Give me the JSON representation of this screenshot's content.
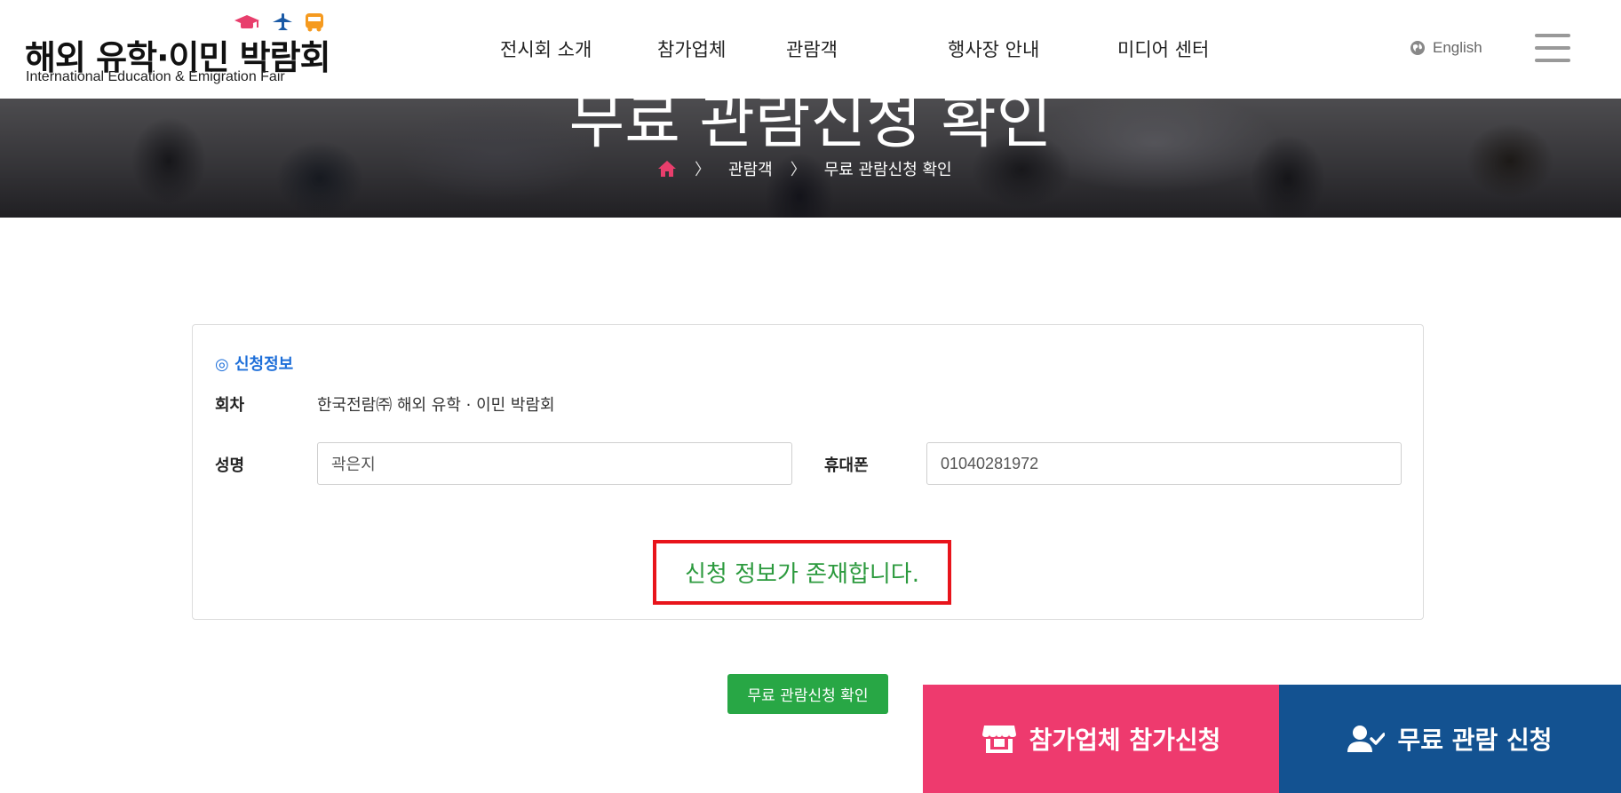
{
  "logo": {
    "title": "해외 유학·이민 박람회",
    "subtitle": "International Education & Emigration Fair",
    "icons": [
      "graduation-cap-icon",
      "airplane-icon",
      "bus-icon"
    ],
    "icon_colors": [
      "#e83e6c",
      "#1a5aa6",
      "#f59a1f"
    ]
  },
  "nav": {
    "items": [
      "전시회 소개",
      "참가업체",
      "관람객",
      "행사장 안내",
      "미디어 센터"
    ],
    "language": "English"
  },
  "banner": {
    "title": "무료 관람신청 확인",
    "breadcrumb": [
      "관람객",
      "무료 관람신청 확인"
    ]
  },
  "info": {
    "section_title": "◎ 신청정보",
    "session_label": "회차",
    "session_value": "한국전람㈜ 해외 유학 · 이민 박람회",
    "name_label": "성명",
    "name_value": "곽은지",
    "phone_label": "휴대폰",
    "phone_value": "01040281972",
    "notice": "신청 정보가 존재합니다."
  },
  "actions": {
    "confirm_label": "무료 관람신청 확인"
  },
  "cta": {
    "exhibitor_label": "참가업체 참가신청",
    "visitor_label": "무료 관람 신청",
    "exhibitor_color": "#ee3a6e",
    "visitor_color": "#135291"
  }
}
